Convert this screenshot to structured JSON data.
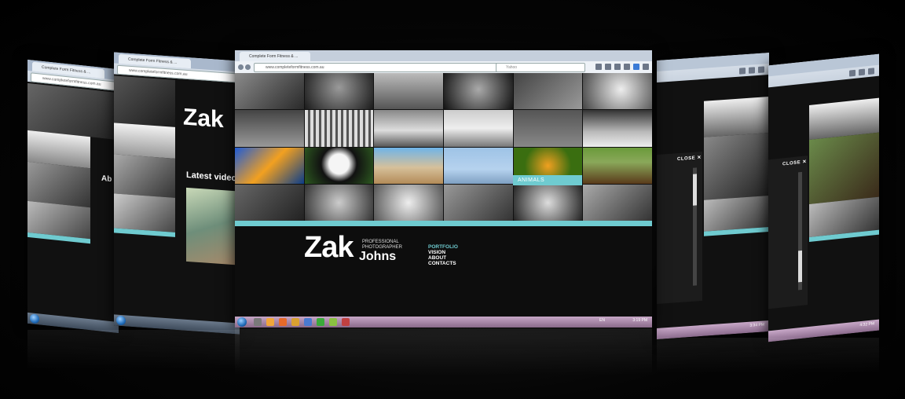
{
  "colors": {
    "teal": "#6fcbd0",
    "dark_bg": "#0d0d0d",
    "accent_text": "#6fcbd0"
  },
  "main_browser": {
    "tab_title": "Complete Form Fitness & ...",
    "url": "www.completeformfitness.com.au",
    "search_placeholder": "Yahoo",
    "category_label": "ANIMALS",
    "brand_first": "Zak",
    "brand_last": "Johns",
    "brand_subtitle": "PROFESSIONAL PHOTOGRAPHER",
    "menu": [
      "PORTFOLIO",
      "VISION",
      "ABOUT",
      "CONTACTS"
    ],
    "clock": "3:19 PM",
    "tray_lang": "EN"
  },
  "left_browser_1": {
    "tab_title": "Complete Form Fitness & ...",
    "url": "www.completeformfitness.com.au",
    "heading_fragment": "Ab"
  },
  "left_browser_2": {
    "tab_title": "Complete Form Fitness & ...",
    "url": "www.completeformfitness.com.au",
    "brand": "Zak",
    "heading": "Latest video"
  },
  "right_browser_1": {
    "close_label": "CLOSE",
    "close_icon": "✕",
    "clock": "3:34 PM"
  },
  "right_browser_2": {
    "close_label": "CLOSE",
    "close_icon": "✕",
    "clock": "4:32 PM"
  },
  "icons": [
    "back-icon",
    "forward-icon",
    "refresh-icon",
    "star-icon",
    "download-icon",
    "home-icon",
    "menu-icon",
    "start-orb-icon",
    "close-icon"
  ]
}
